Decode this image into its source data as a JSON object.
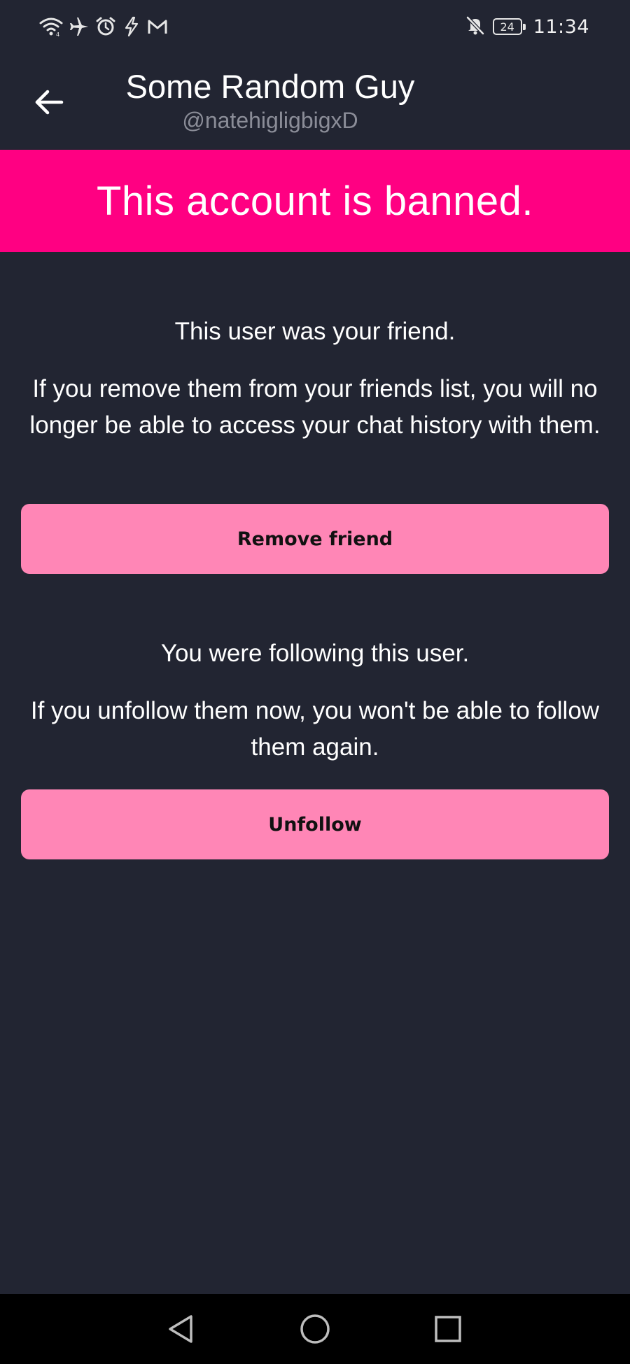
{
  "status_bar": {
    "time": "11:34",
    "battery": "24",
    "left_icons": [
      "wifi-icon",
      "airplane-icon",
      "alarm-icon",
      "charging-bolt-icon",
      "gmail-icon"
    ],
    "right_icons": [
      "notifications-muted-icon",
      "battery-icon"
    ]
  },
  "header": {
    "title": "Some Random Guy",
    "handle": "@natehigligbigxD",
    "back_icon": "arrow-back-icon"
  },
  "banner": {
    "text": "This account is banned.",
    "color": "#ff0082"
  },
  "friend_section": {
    "heading": "This user was your friend.",
    "body": "If you remove them from your friends list, you will no longer be able to access your chat history with them.",
    "button_label": "Remove friend"
  },
  "follow_section": {
    "heading": "You were following this user.",
    "body": "If you unfollow them now, you won't be able to follow them again.",
    "button_label": "Unfollow"
  },
  "nav_bar": {
    "icons": [
      "nav-back-icon",
      "nav-home-icon",
      "nav-recents-icon"
    ]
  },
  "colors": {
    "background": "#222532",
    "accent": "#ff0082",
    "button": "#ff86b6",
    "subtext": "#8b8d98"
  }
}
